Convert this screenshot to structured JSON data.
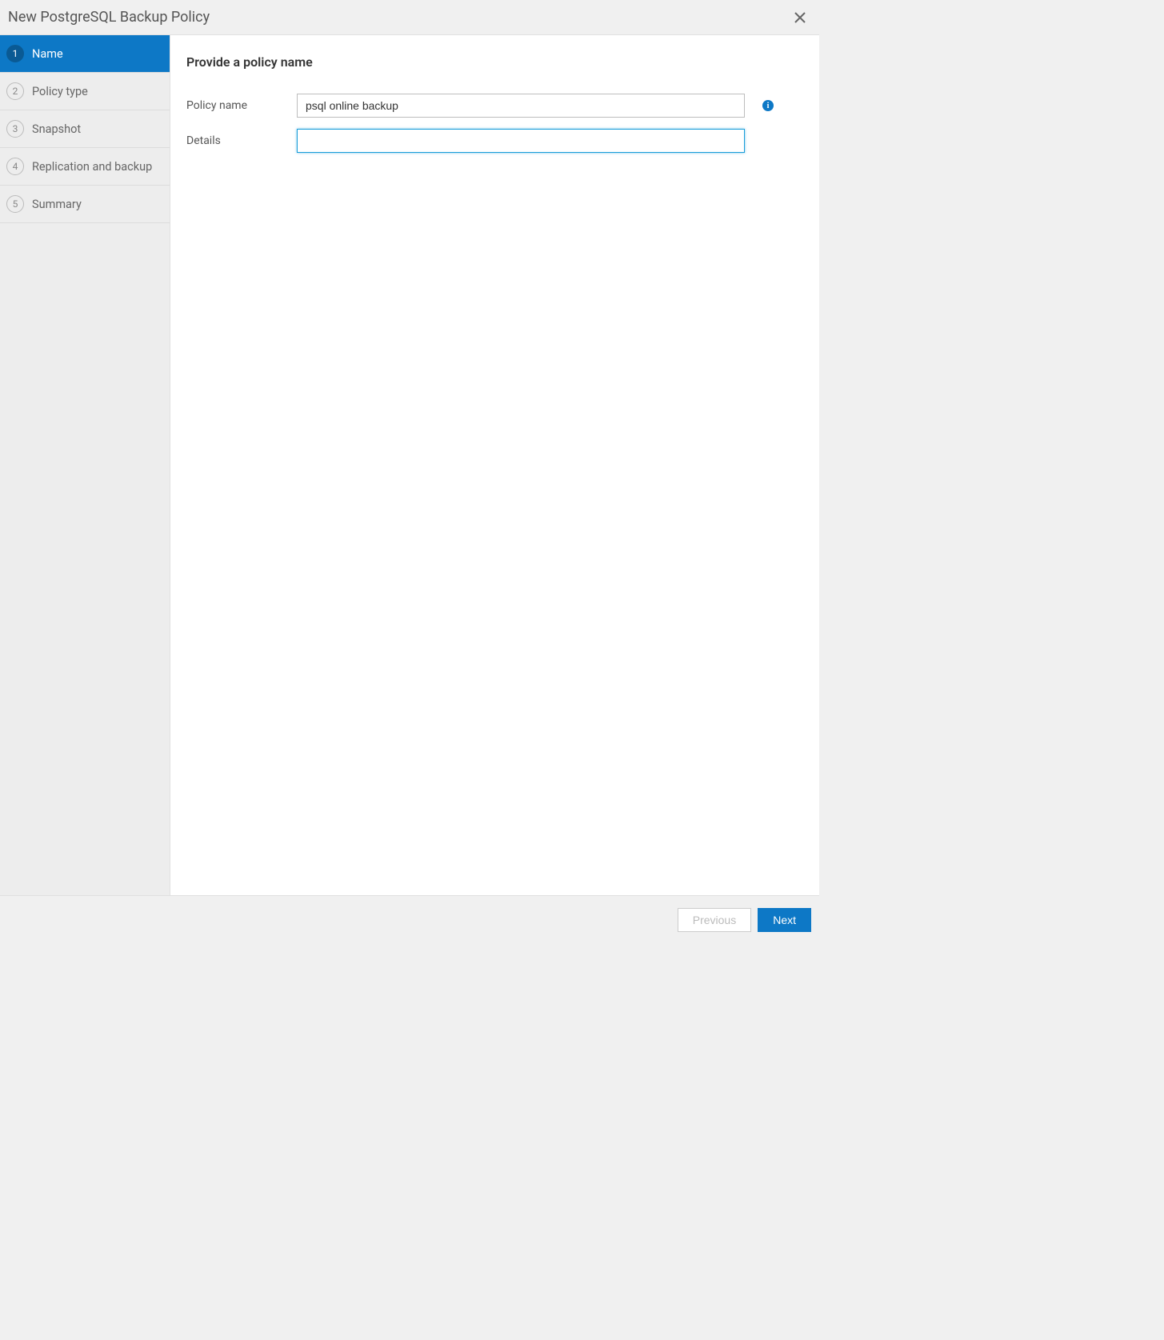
{
  "header": {
    "title": "New PostgreSQL Backup Policy"
  },
  "sidebar": {
    "steps": [
      {
        "num": "1",
        "label": "Name",
        "active": true
      },
      {
        "num": "2",
        "label": "Policy type",
        "active": false
      },
      {
        "num": "3",
        "label": "Snapshot",
        "active": false
      },
      {
        "num": "4",
        "label": "Replication and backup",
        "active": false
      },
      {
        "num": "5",
        "label": "Summary",
        "active": false
      }
    ]
  },
  "main": {
    "heading": "Provide a policy name",
    "fields": {
      "policyName": {
        "label": "Policy name",
        "value": "psql online backup"
      },
      "details": {
        "label": "Details",
        "value": ""
      }
    }
  },
  "footer": {
    "previous": "Previous",
    "next": "Next"
  }
}
